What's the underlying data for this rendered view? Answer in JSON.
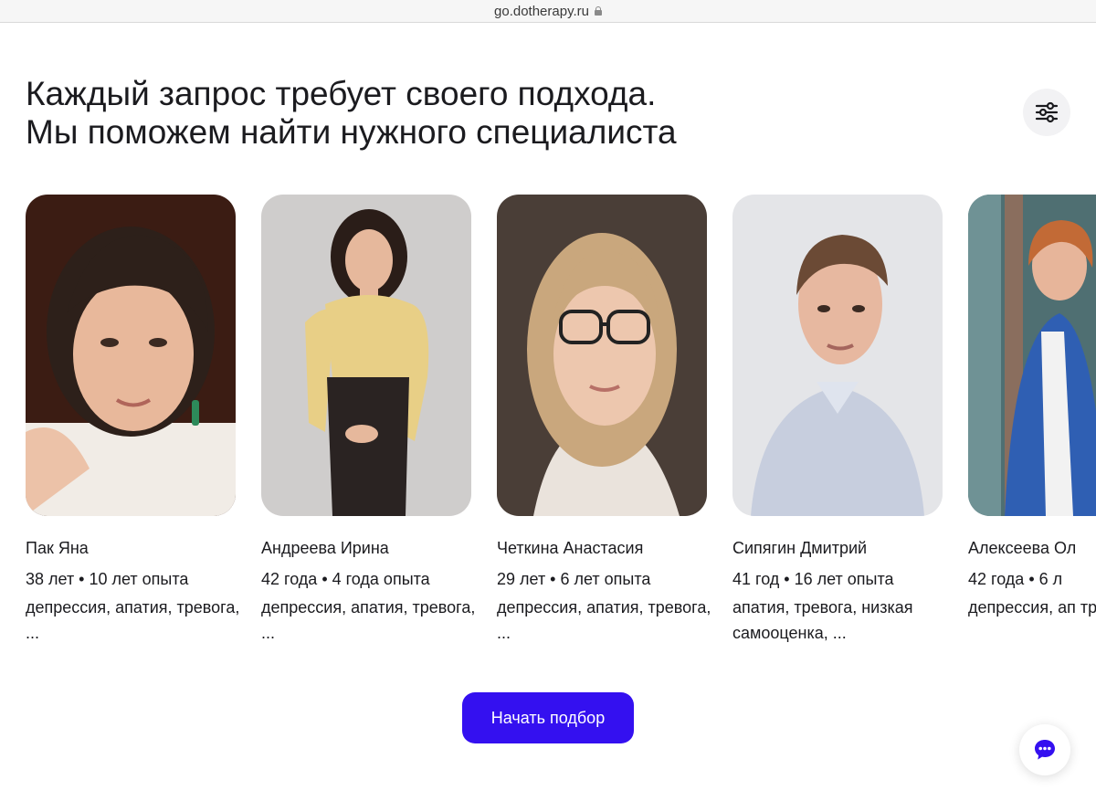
{
  "browser": {
    "url": "go.dotherapy.ru"
  },
  "header": {
    "title_line1": "Каждый запрос требует своего подхода.",
    "title_line2": "Мы поможем найти нужного специалиста"
  },
  "filter_icon": "sliders-icon",
  "specialists": [
    {
      "name": "Пак Яна",
      "meta": "38 лет • 10 лет опыта",
      "tags": "депрессия, апатия, тревога, ..."
    },
    {
      "name": "Андреева Ирина",
      "meta": "42 года • 4 года опыта",
      "tags": "депрессия, апатия, тревога, ..."
    },
    {
      "name": "Четкина Анастасия",
      "meta": "29 лет • 6 лет опыта",
      "tags": "депрессия, апатия, тревога, ..."
    },
    {
      "name": "Сипягин Дмитрий",
      "meta": "41 год • 16 лет опыта",
      "tags": "апатия, тревога, низкая самооценка, ..."
    },
    {
      "name": "Алексеева Ол",
      "meta": "42 года • 6 л",
      "tags": "депрессия, ап тревога, ..."
    }
  ],
  "actions": {
    "start_label": "Начать подбор"
  },
  "chat_icon": "chat-bubble-icon",
  "colors": {
    "accent": "#3410f0",
    "text": "#1b1b1f",
    "filter_bg": "#f2f2f4"
  }
}
